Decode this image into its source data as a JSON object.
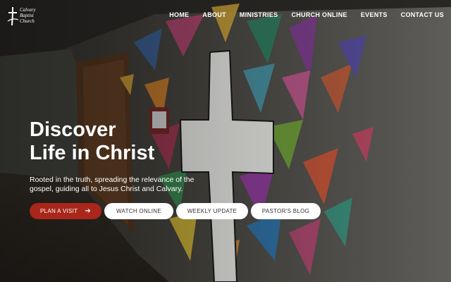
{
  "site": {
    "logo_line1": "Calvary Baptist",
    "logo_line2": "Church"
  },
  "nav": {
    "items": [
      "HOME",
      "ABOUT",
      "MINISTRIES",
      "CHURCH ONLINE",
      "EVENTS",
      "CONTACT US"
    ]
  },
  "hero": {
    "title_line1": "Discover",
    "title_line2": "Life in Christ",
    "subtitle": "Rooted in the truth, spreading the relevance of the gospel, guiding all to Jesus Christ and Calvary.",
    "buttons": [
      "PLAN A VISIT",
      "WATCH ONLINE",
      "WEEKLY UPDATE",
      "PASTOR'S BLOG"
    ]
  },
  "colors": {
    "accent": "#a9261b",
    "text_on_dark": "#ffffff"
  }
}
